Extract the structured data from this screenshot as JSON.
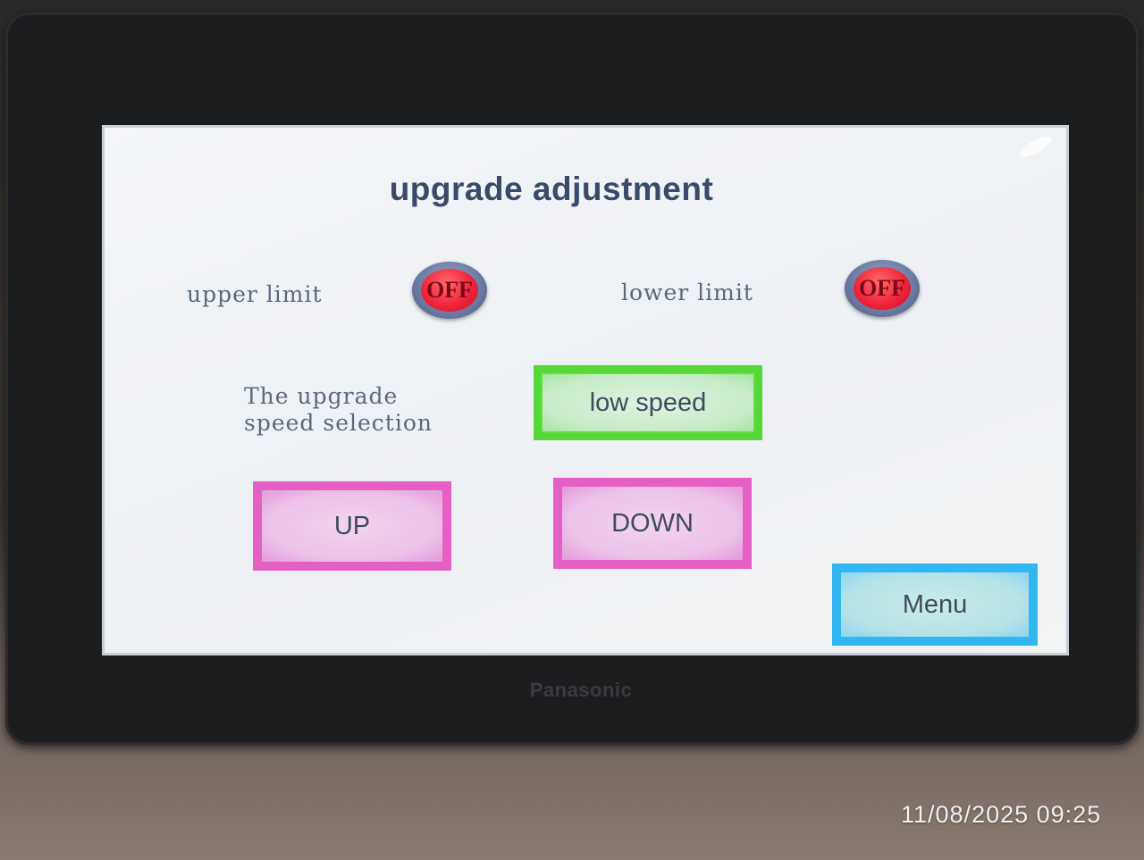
{
  "screen": {
    "title": "upgrade adjustment",
    "upper_limit": {
      "label": "upper limit",
      "lamp_text": "OFF"
    },
    "lower_limit": {
      "label": "lower limit",
      "lamp_text": "OFF"
    },
    "speed_selection": {
      "label_line1": "The upgrade",
      "label_line2": "speed selection",
      "button_label": "low speed"
    },
    "up_button": "UP",
    "down_button": "DOWN",
    "menu_button": "Menu"
  },
  "device": {
    "brand": "Panasonic"
  },
  "photo": {
    "timestamp": "11/08/2025 09:25"
  },
  "colors": {
    "speed_button": "#5de23d",
    "jog_buttons": "#e65fc4",
    "menu_button": "#33b7f3",
    "lamp_off": "#f0253a",
    "title": "#3a4a6a"
  }
}
